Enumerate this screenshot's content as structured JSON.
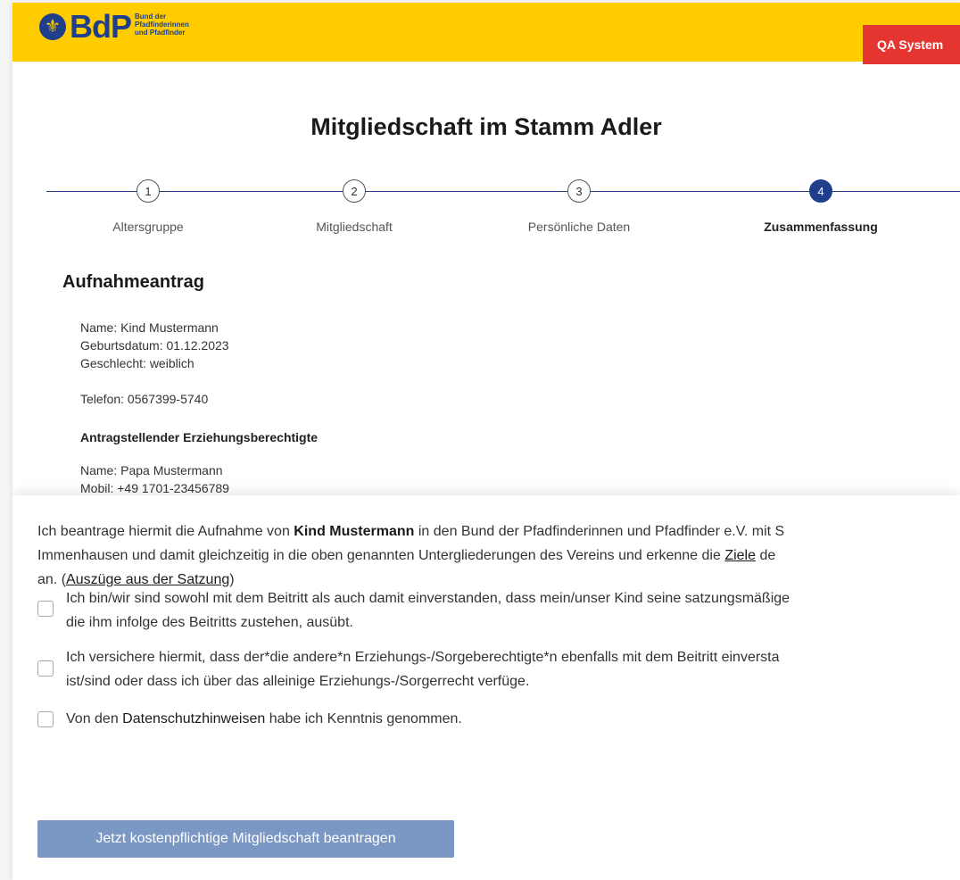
{
  "header": {
    "logo_symbol": "⚜",
    "logo_text": "BdP",
    "logo_sub": [
      "Bund der",
      "Pfadfinderinnen",
      "und Pfadfinder"
    ],
    "qa_badge": "QA System",
    "brand_color": "#ffcc00",
    "accent_color": "#1f3f8c",
    "badge_color": "#e53530"
  },
  "page_title": "Mitgliedschaft im Stamm Adler",
  "stepper": {
    "steps": [
      {
        "number": "1",
        "label": "Altersgruppe",
        "active": false
      },
      {
        "number": "2",
        "label": "Mitgliedschaft",
        "active": false
      },
      {
        "number": "3",
        "label": "Persönliche Daten",
        "active": false
      },
      {
        "number": "4",
        "label": "Zusammenfassung",
        "active": true
      }
    ]
  },
  "summary": {
    "heading": "Aufnahmeantrag",
    "child": {
      "name": "Name: Kind Mustermann",
      "birthdate": "Geburtsdatum: 01.12.2023",
      "gender": "Geschlecht: weiblich",
      "phone": "Telefon: 0567399-5740"
    },
    "guardian_heading": "Antragstellender Erziehungsberechtigte",
    "guardian": {
      "name": "Name: Papa Mustermann",
      "mobile": "Mobil: +49 1701-23456789"
    }
  },
  "consent": {
    "intro_part1": "Ich beantrage hiermit die Aufnahme von ",
    "intro_child": "Kind Mustermann",
    "intro_part2": " in den Bund der Pfadfinderinnen und Pfadfinder e.V. mit S",
    "intro_line2a": "Immenhausen und damit gleichzeitig in die oben genannten Untergliederungen des Vereins und erkenne die ",
    "intro_link_ziele": "Ziele",
    "intro_line2b": " de",
    "intro_line3a": "an. (",
    "intro_link_satzung": "Auszüge aus der Satzung",
    "intro_line3b": ")",
    "checkbox1_line1": "Ich bin/wir sind sowohl mit dem Beitritt als auch damit einverstanden, dass mein/unser Kind seine satzungsmäßige",
    "checkbox1_line2": "die ihm infolge des Beitritts zustehen, ausübt.",
    "checkbox2_line1": "Ich versichere hiermit, dass der*die andere*n Erziehungs-/Sorgeberechtigte*n ebenfalls mit dem Beitritt einversta",
    "checkbox2_line2": "ist/sind oder dass ich über das alleinige Erziehungs-/Sorgerrecht verfüge.",
    "checkbox3_before": "Von den ",
    "checkbox3_link": "Datenschutzhinweisen",
    "checkbox3_after": " habe ich Kenntnis genommen.",
    "submit_label": "Jetzt kostenpflichtige Mitgliedschaft beantragen"
  }
}
